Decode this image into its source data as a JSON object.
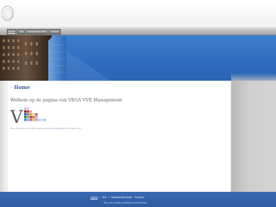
{
  "nav": {
    "items": [
      {
        "label": "Home"
      },
      {
        "label": "link"
      },
      {
        "label": "Vastgoedprofiles"
      },
      {
        "label": "Contact"
      }
    ]
  },
  "content": {
    "breadcrumb": "Home",
    "heading": "Welkom op de pagina van VEGA VVE Management",
    "tagline": "Deze website zal worden aangevuld met belangrijke informatie die..."
  },
  "footer": {
    "links": [
      {
        "label": "Home"
      },
      {
        "label": "link"
      },
      {
        "label": "Vastgoedprofiles"
      },
      {
        "label": "Contact"
      }
    ],
    "separator": "•",
    "note": "Web site ontwerp website onderhouden"
  },
  "colors": {
    "footer": "#2f5da3",
    "banner_sky": "#3d7fcb",
    "breadcrumb": "#3a5f9a"
  }
}
